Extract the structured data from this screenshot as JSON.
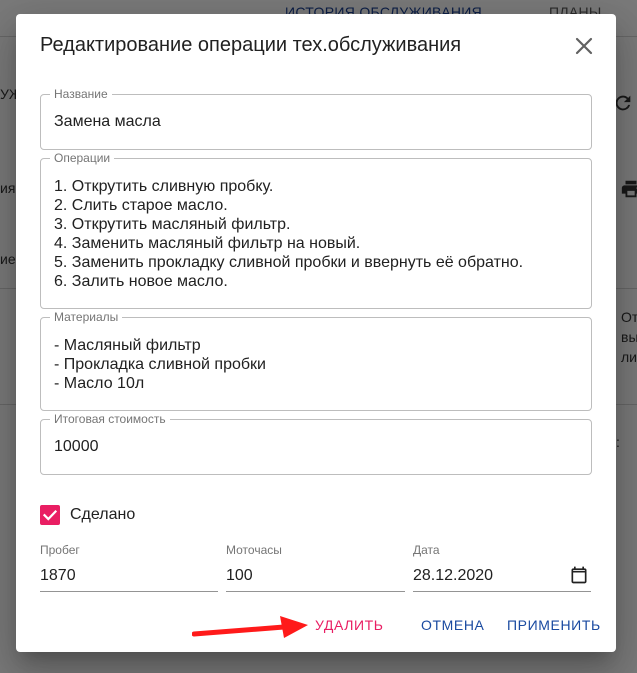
{
  "background": {
    "tab_history": "ИСТОРИЯ ОБСЛУЖИВАНИЯ",
    "tab_plans": "ПЛАНЫ",
    "frag_left_1": "УЖ",
    "frag_left_2": "ия",
    "frag_left_3": "ие",
    "frag_right_1": "От",
    "frag_right_2": "вы",
    "frag_right_3": "ли",
    "frag_right_4": ":"
  },
  "dialog": {
    "title": "Редактирование операции тех.обслуживания",
    "fields": {
      "name": {
        "label": "Название",
        "value": "Замена масла"
      },
      "operations": {
        "label": "Операции",
        "value": "1. Открутить сливную пробку.\n2. Слить старое масло.\n3. Открутить масляный фильтр.\n4. Заменить масляный фильтр на новый.\n5. Заменить прокладку сливной пробки и ввернуть её обратно.\n6. Залить новое масло."
      },
      "materials": {
        "label": "Материалы",
        "value": "- Масляный фильтр\n- Прокладка сливной пробки\n- Масло 10л"
      },
      "total_cost": {
        "label": "Итоговая стоимость",
        "value": "10000"
      }
    },
    "done": {
      "label": "Сделано",
      "checked": true
    },
    "mileage": {
      "label": "Пробег",
      "value": "1870"
    },
    "engine_hours": {
      "label": "Моточасы",
      "value": "100"
    },
    "date": {
      "label": "Дата",
      "value": "28.12.2020"
    },
    "actions": {
      "delete": "УДАЛИТЬ",
      "cancel": "ОТМЕНА",
      "apply": "ПРИМЕНИТЬ"
    }
  },
  "colors": {
    "accent_pink": "#e91e63",
    "primary_blue": "#1a4aa0",
    "annotation_arrow": "#ff1a1a"
  },
  "icons": {
    "close": "close-icon",
    "checkbox": "check-icon",
    "calendar": "calendar-icon",
    "annotation": "red-arrow-icon"
  }
}
